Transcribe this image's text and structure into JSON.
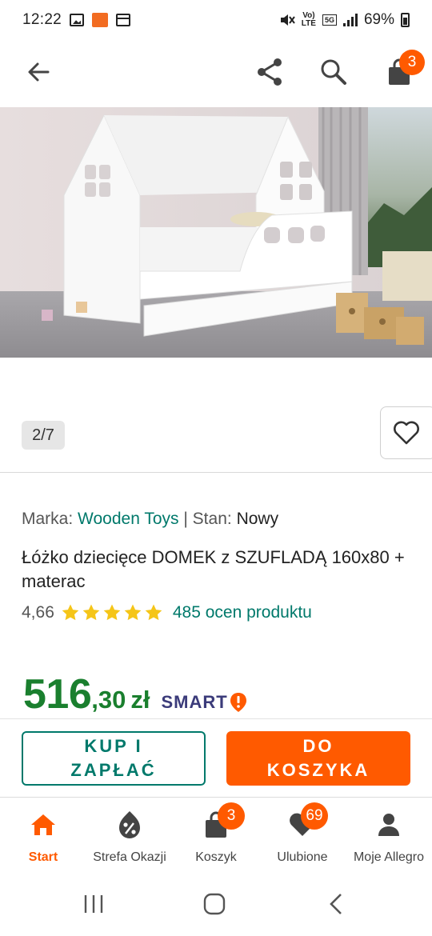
{
  "status_bar": {
    "time": "12:22",
    "network_small": "Vo)\nLTE",
    "network_5g": "5G",
    "battery": "69%"
  },
  "top_nav": {
    "cart_count": "3",
    "icons": [
      "back-arrow-icon",
      "share-icon",
      "search-icon",
      "shopping-bag-icon"
    ]
  },
  "gallery": {
    "counter": "2/7"
  },
  "product": {
    "brand_label": "Marka:",
    "brand": "Wooden Toys",
    "separator": "|",
    "condition_label": "Stan:",
    "condition": "Nowy",
    "title": "Łóżko dziecięce DOMEK z SZUFLADĄ 160x80 + materac",
    "rating": "4,66",
    "stars": 5,
    "reviews": "485 ocen produktu",
    "price_main": "516",
    "price_frac": ",30",
    "currency": "zł",
    "smart_label": "SMART"
  },
  "actions": {
    "buy_now_line1": "KUP I",
    "buy_now_line2": "ZAPŁAĆ",
    "add_to_cart_line1": "DO",
    "add_to_cart_line2": "KOSZYKA"
  },
  "bottom_nav": {
    "items": [
      {
        "label": "Start",
        "icon": "home-icon",
        "active": true
      },
      {
        "label": "Strefa Okazji",
        "icon": "discount-icon"
      },
      {
        "label": "Koszyk",
        "icon": "cart-bag-icon",
        "badge": "3"
      },
      {
        "label": "Ulubione",
        "icon": "heart-icon",
        "badge": "69"
      },
      {
        "label": "Moje Allegro",
        "icon": "user-icon"
      }
    ]
  },
  "colors": {
    "accent": "#ff5a00",
    "link": "#00796b",
    "price": "#1a7f2e"
  }
}
